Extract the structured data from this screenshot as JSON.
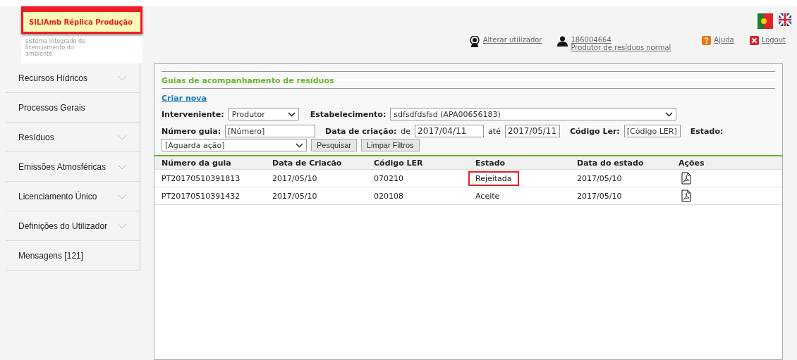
{
  "header": {
    "logo_title": "SILiAmb Réplica Produção",
    "logo_subtitle": "sistema integrado de licenciamento do ambiente",
    "switch_user": "Alterar utilizador",
    "user_id": "186004664",
    "user_role": "Produtor de resíduos normal",
    "help": "Ajuda",
    "logout": "Logout"
  },
  "sidebar": {
    "items": [
      {
        "label": "Recursos Hídricos",
        "expandable": true
      },
      {
        "label": "Processos Gerais",
        "expandable": false
      },
      {
        "label": "Resíduos",
        "expandable": true
      },
      {
        "label": "Emissões Atmosféricas",
        "expandable": true
      },
      {
        "label": "Licenciamento Único",
        "expandable": true
      },
      {
        "label": "Definições do Utilizador",
        "expandable": true
      },
      {
        "label": "Mensagens [121]",
        "expandable": false
      }
    ]
  },
  "panel": {
    "title": "Guias de acompanhamento de resíduos",
    "create_link": "Criar nova",
    "filters": {
      "interveniente_label": "Interveniente:",
      "interveniente_value": "Produtor",
      "estabelecimento_label": "Estabelecimento:",
      "estabelecimento_value": "sdfsdfdsfsd (APA00656183)",
      "numero_label": "Número guia:",
      "numero_placeholder": "[Número]",
      "data_label": "Data de criação:",
      "de_label": "de",
      "date_from": "2017/04/11",
      "ate_label": "até",
      "date_to": "2017/05/11",
      "codigo_label": "Código Ler:",
      "codigo_placeholder": "[Código LER]",
      "estado_label": "Estado:",
      "estado_value": "[Aguarda ação]",
      "search_button": "Pesquisar",
      "clear_button": "Limpar Filtros"
    },
    "table": {
      "columns": [
        "Número da guia",
        "Data de Criacão",
        "Código LER",
        "Estado",
        "Data do estado",
        "Ações"
      ],
      "rows": [
        {
          "numero": "PT20170510391813",
          "data": "2017/05/10",
          "codigo": "070210",
          "estado": "Rejeitada",
          "data_estado": "2017/05/10",
          "highlighted": true
        },
        {
          "numero": "PT20170510391432",
          "data": "2017/05/10",
          "codigo": "020108",
          "estado": "Aceite",
          "data_estado": "2017/05/10",
          "highlighted": false
        }
      ]
    }
  }
}
